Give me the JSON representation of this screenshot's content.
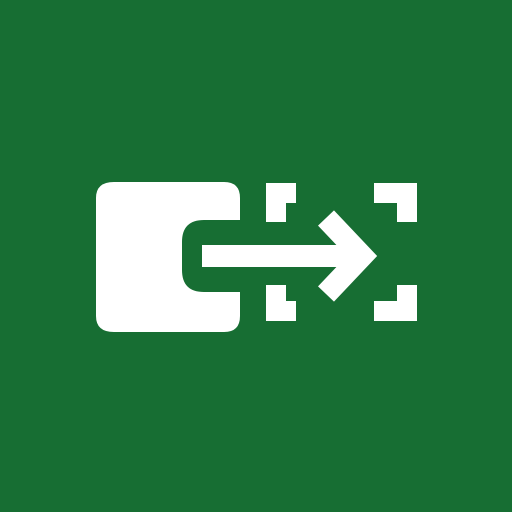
{
  "icon": {
    "name": "move-to-selection-icon",
    "background_color": "#176e33",
    "foreground_color": "#ffffff"
  }
}
